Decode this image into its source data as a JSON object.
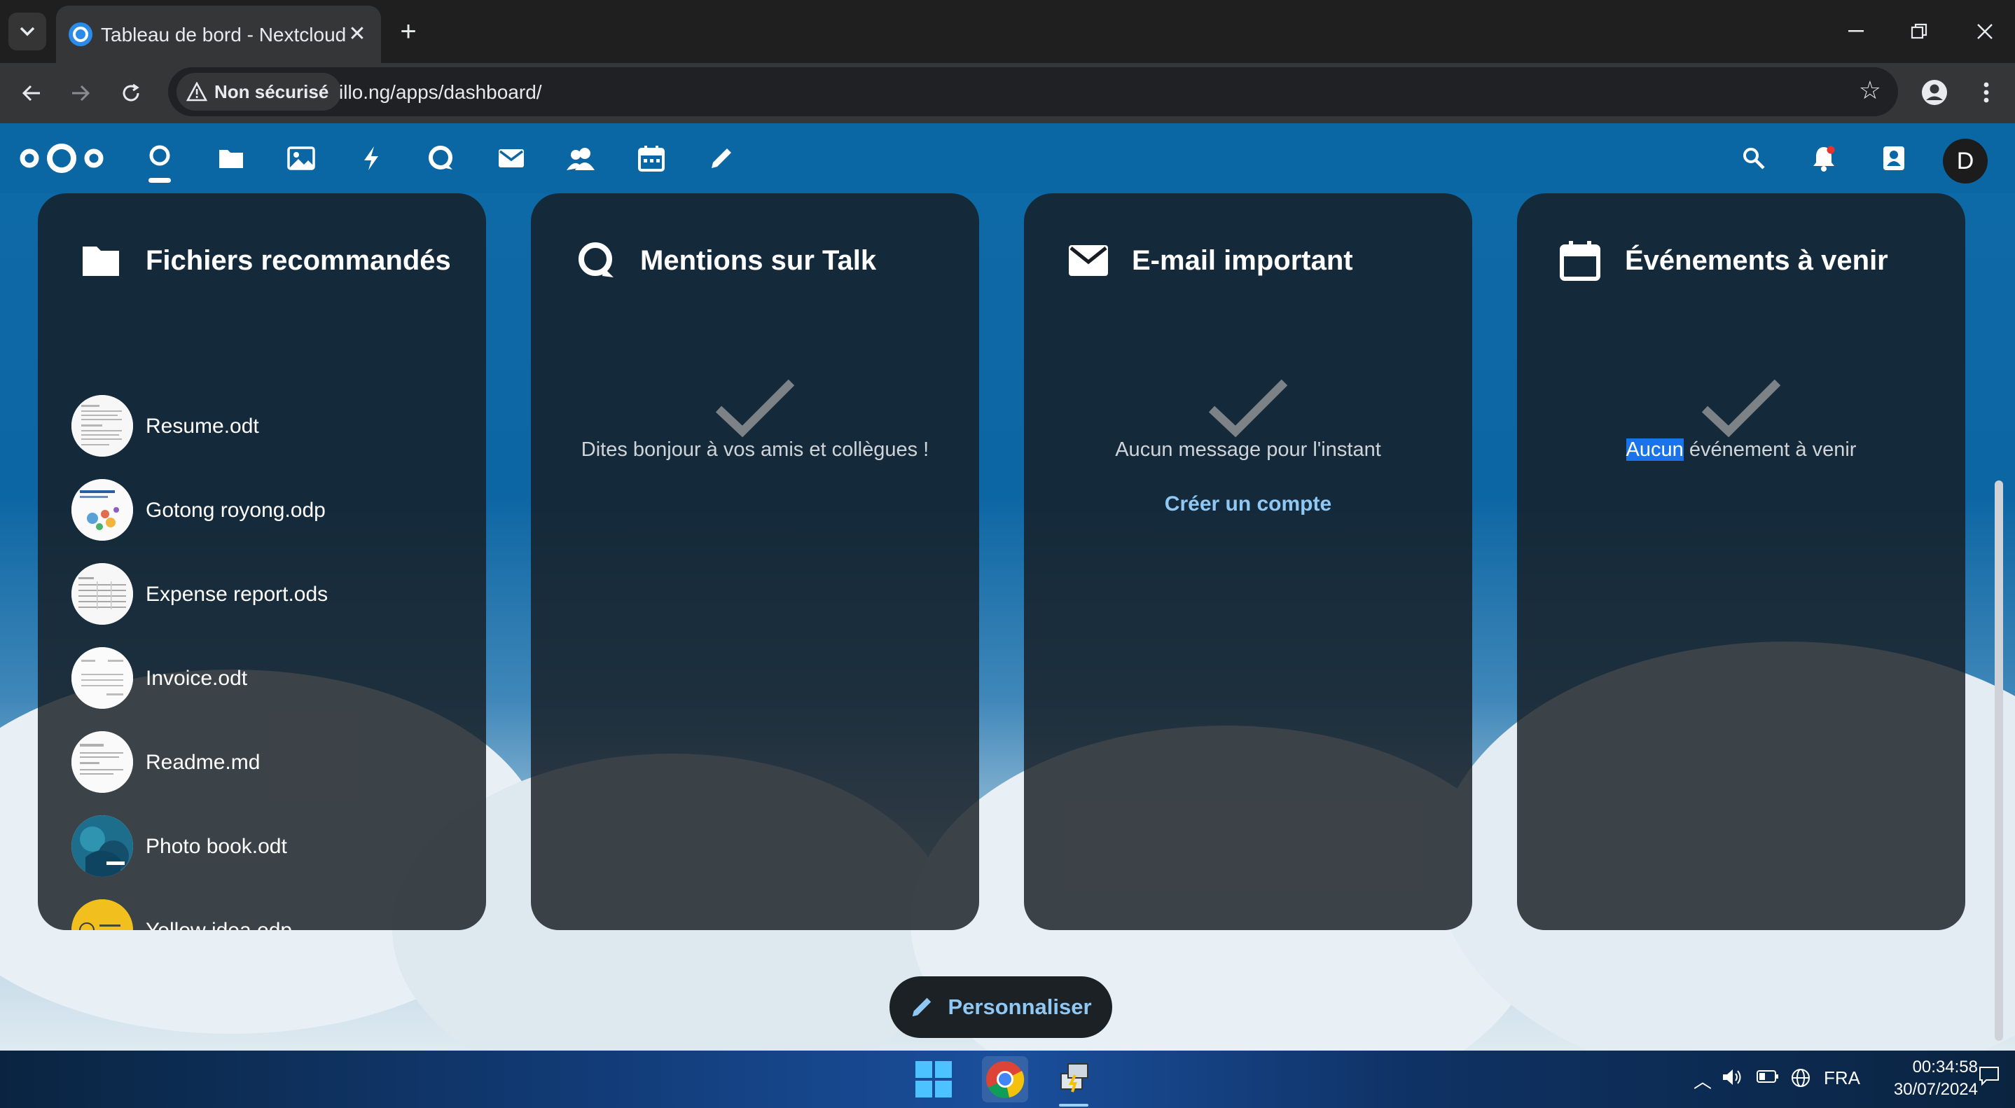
{
  "browser": {
    "tab_title": "Tableau de bord - Nextcloud",
    "security_label": "Non sécurisé",
    "url": "illo.ng/apps/dashboard/"
  },
  "nav": {
    "apps": [
      "dashboard-icon",
      "files-icon",
      "photos-icon",
      "activity-icon",
      "talk-icon",
      "mail-icon",
      "contacts-icon",
      "calendar-icon",
      "notes-icon"
    ],
    "avatar_letter": "D"
  },
  "widgets": {
    "files": {
      "title": "Fichiers recommandés",
      "items": [
        {
          "name": "Resume.odt"
        },
        {
          "name": "Gotong royong.odp"
        },
        {
          "name": "Expense report.ods"
        },
        {
          "name": "Invoice.odt"
        },
        {
          "name": "Readme.md"
        },
        {
          "name": "Photo book.odt"
        },
        {
          "name": "Yellow idea.odp"
        }
      ]
    },
    "talk": {
      "title": "Mentions sur Talk",
      "empty": "Dites bonjour à vos amis et collègues !"
    },
    "mail": {
      "title": "E-mail important",
      "empty": "Aucun message pour l'instant",
      "action": "Créer un compte"
    },
    "calendar": {
      "title": "Événements à venir",
      "empty_selected": "Aucun",
      "empty_rest": " événement à venir"
    }
  },
  "customize_label": "Personnaliser",
  "taskbar": {
    "language": "FRA",
    "time": "00:34:58",
    "date": "30/07/2024"
  },
  "colors": {
    "nextcloud_blue": "#0a67a3",
    "panel_bg": "#161c22",
    "link_accent": "#8fc8f4"
  }
}
